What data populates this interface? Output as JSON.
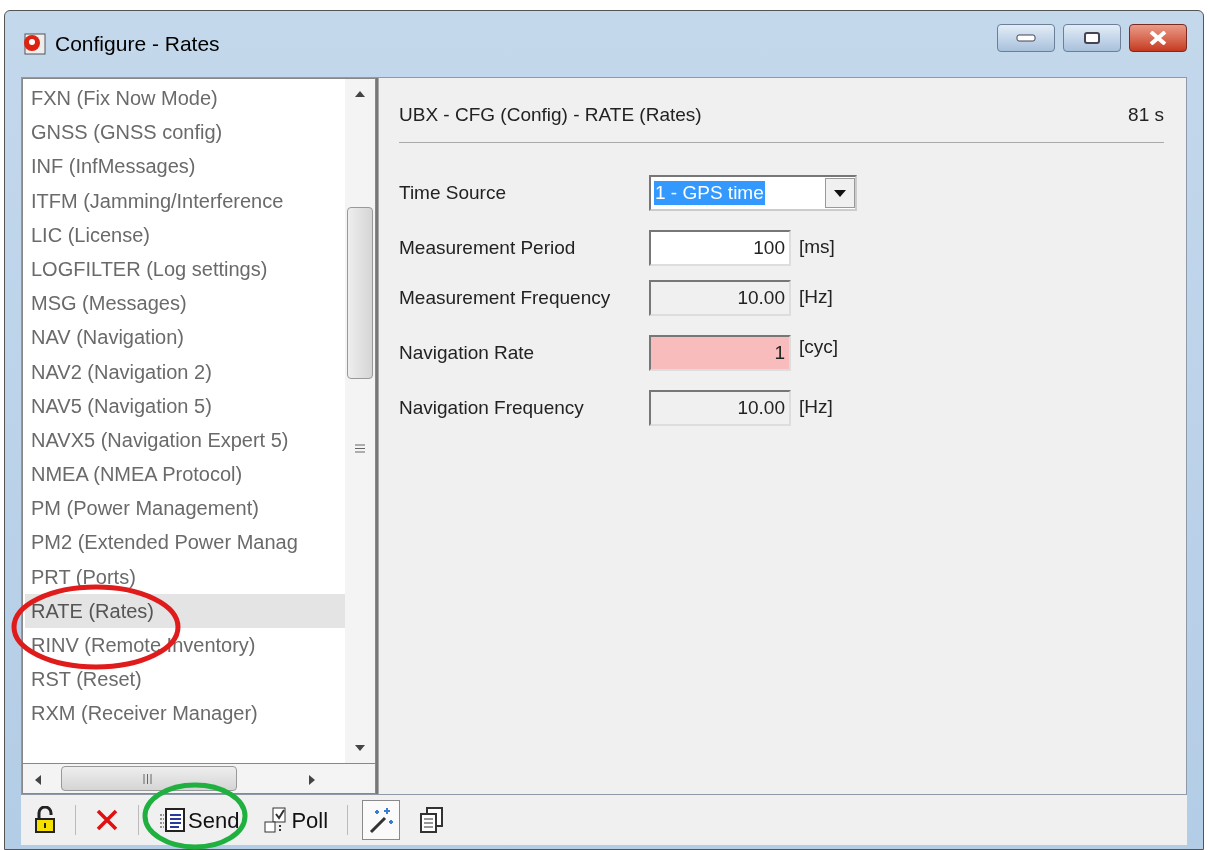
{
  "window": {
    "title": "Configure - Rates"
  },
  "sidebar": {
    "items": [
      {
        "label": "FXN (Fix Now Mode)",
        "selected": false
      },
      {
        "label": "GNSS (GNSS config)",
        "selected": false
      },
      {
        "label": "INF (InfMessages)",
        "selected": false
      },
      {
        "label": "ITFM (Jamming/Interference",
        "selected": false
      },
      {
        "label": "LIC (License)",
        "selected": false
      },
      {
        "label": "LOGFILTER (Log settings)",
        "selected": false
      },
      {
        "label": "MSG (Messages)",
        "selected": false
      },
      {
        "label": "NAV (Navigation)",
        "selected": false
      },
      {
        "label": "NAV2 (Navigation 2)",
        "selected": false
      },
      {
        "label": "NAV5 (Navigation 5)",
        "selected": false
      },
      {
        "label": "NAVX5 (Navigation Expert 5)",
        "selected": false
      },
      {
        "label": "NMEA (NMEA Protocol)",
        "selected": false
      },
      {
        "label": "PM (Power Management)",
        "selected": false
      },
      {
        "label": "PM2 (Extended Power Manag",
        "selected": false
      },
      {
        "label": "PRT (Ports)",
        "selected": false
      },
      {
        "label": "RATE (Rates)",
        "selected": true
      },
      {
        "label": "RINV (Remote Inventory)",
        "selected": false
      },
      {
        "label": "RST (Reset)",
        "selected": false
      },
      {
        "label": "RXM (Receiver Manager)",
        "selected": false
      }
    ]
  },
  "panel": {
    "title": "UBX - CFG (Config) - RATE (Rates)",
    "age": "81 s",
    "fields": [
      {
        "kind": "dropdown",
        "label": "Time Source",
        "value": "1 - GPS time"
      },
      {
        "kind": "input",
        "label": "Measurement Period",
        "value": "100",
        "unit": "[ms]",
        "readonly": false,
        "invalid": false
      },
      {
        "kind": "input",
        "label": "Measurement Frequency",
        "value": "10.00",
        "unit": "[Hz]",
        "readonly": true,
        "invalid": false
      },
      {
        "kind": "input",
        "label": "Navigation Rate",
        "value": "1",
        "unit": "[cyc]",
        "readonly": false,
        "invalid": true
      },
      {
        "kind": "input",
        "label": "Navigation Frequency",
        "value": "10.00",
        "unit": "[Hz]",
        "readonly": true,
        "invalid": false
      }
    ]
  },
  "toolbar": [
    {
      "kind": "lock",
      "pressed": false
    },
    {
      "kind": "delete",
      "pressed": false
    },
    {
      "kind": "send",
      "label": "Send",
      "pressed": false
    },
    {
      "kind": "poll",
      "label": "Poll",
      "pressed": false
    },
    {
      "kind": "wand",
      "pressed": true
    },
    {
      "kind": "copy",
      "pressed": false
    }
  ]
}
